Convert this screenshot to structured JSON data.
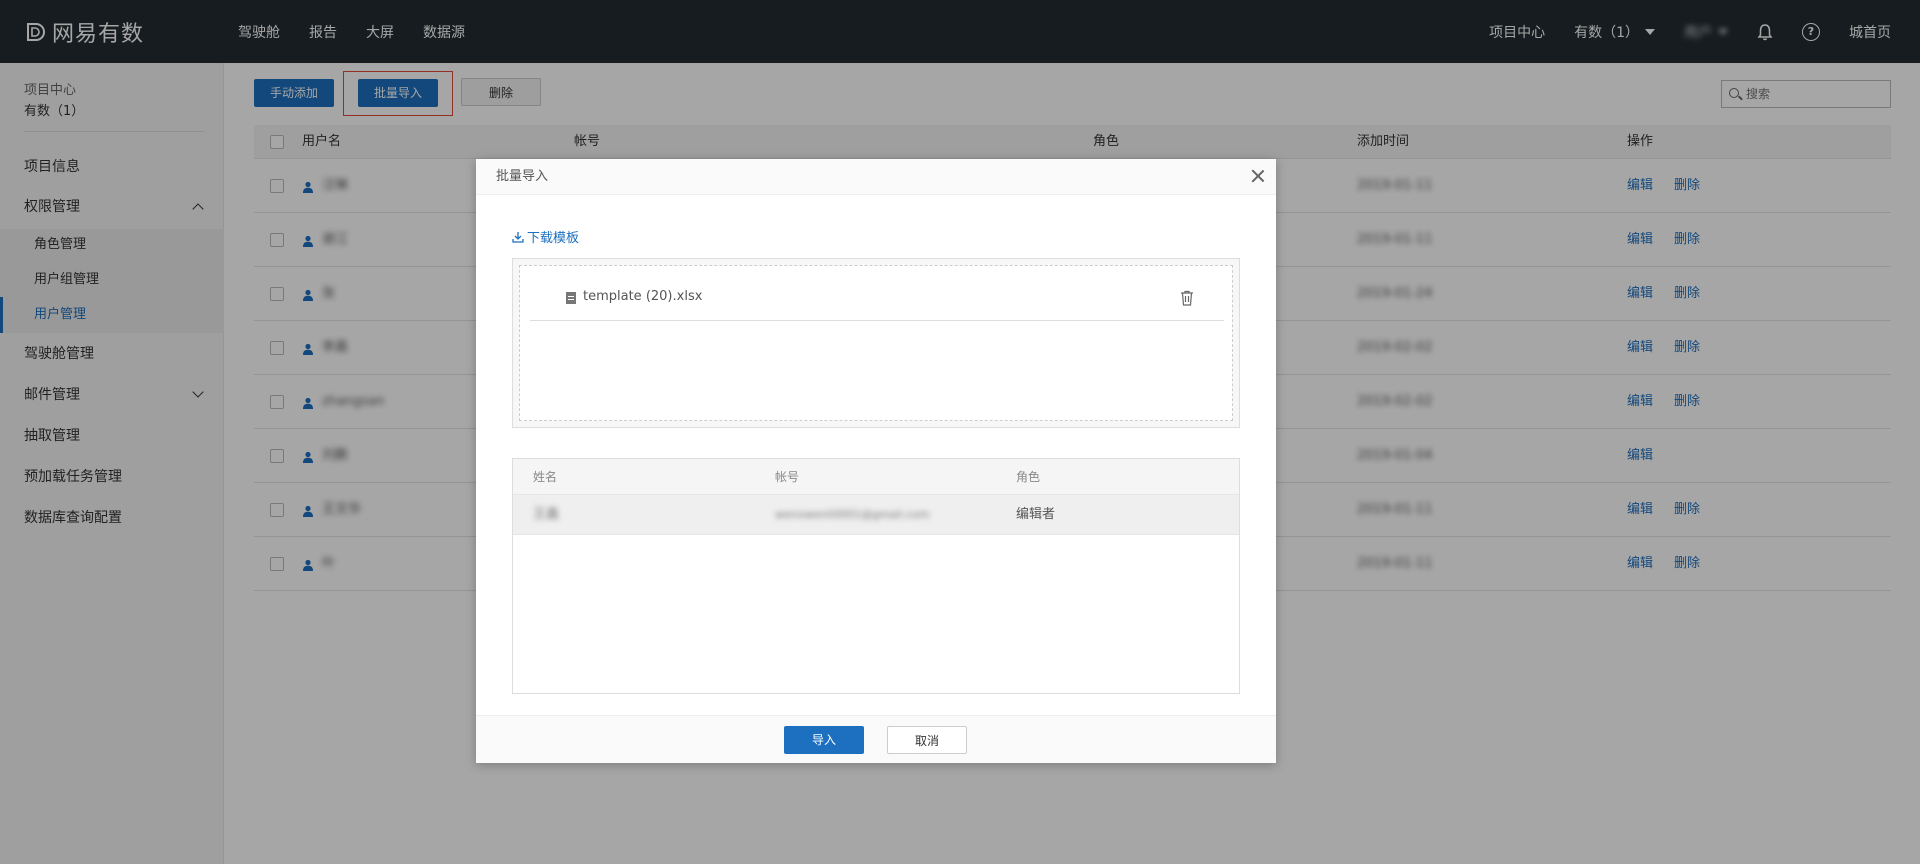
{
  "app": {
    "logo_text": "网易有数"
  },
  "topnav": [
    "驾驶舱",
    "报告",
    "大屏",
    "数据源"
  ],
  "topright": {
    "project_center": "项目中心",
    "current_project": "有数（1）",
    "user": "用户",
    "bell_icon": "bell-icon",
    "help_icon": "help-icon",
    "home": "城首页"
  },
  "sidebar": {
    "project_caption": "项目中心",
    "project_name": "有数（1）",
    "items": [
      {
        "label": "项目信息"
      },
      {
        "label": "权限管理",
        "expanded": true
      },
      {
        "label": "角色管理"
      },
      {
        "label": "用户组管理"
      },
      {
        "label": "用户管理",
        "active": true
      },
      {
        "label": "驾驶舱管理"
      },
      {
        "label": "邮件管理",
        "expanded": false
      },
      {
        "label": "抽取管理"
      },
      {
        "label": "预加载任务管理"
      },
      {
        "label": "数据库查询配置"
      }
    ]
  },
  "toolbar": {
    "add_label": "手动添加",
    "import_label": "批量导入",
    "delete_label": "删除",
    "search_placeholder": "搜索"
  },
  "table": {
    "headers": [
      "用户名",
      "帐号",
      "角色",
      "添加时间",
      "操作"
    ],
    "rows": [
      {
        "name": "汪琳",
        "added": "2019-01-11",
        "actions": [
          "编辑",
          "删除"
        ]
      },
      {
        "name": "谢江",
        "added": "2019-01-11",
        "actions": [
          "编辑",
          "删除"
        ]
      },
      {
        "name": "张",
        "added": "2019-01-24",
        "actions": [
          "编辑",
          "删除"
        ]
      },
      {
        "name": "李晨",
        "added": "2019-02-02",
        "actions": [
          "编辑",
          "删除"
        ]
      },
      {
        "name": "zhangsan",
        "added": "2019-02-02",
        "actions": [
          "编辑",
          "删除"
        ]
      },
      {
        "name": "刘鹏",
        "added": "2019-01-04",
        "actions": [
          "编辑"
        ]
      },
      {
        "name": "王文华",
        "added": "2019-01-11",
        "actions": [
          "编辑",
          "删除"
        ]
      },
      {
        "name": "叶",
        "added": "2019-01-11",
        "actions": [
          "编辑",
          "删除"
        ]
      }
    ]
  },
  "dialog": {
    "title": "批量导入",
    "download_label": "下载模板",
    "file_name": "template (20).xlsx",
    "preview_headers": [
      "姓名",
      "帐号",
      "角色"
    ],
    "preview_rows": [
      {
        "name": "王鑫",
        "account": "wenxwenli0001@gmail.com",
        "role": "编辑者"
      }
    ],
    "import_label": "导入",
    "cancel_label": "取消"
  },
  "colors": {
    "accent": "#1d6fbf",
    "topbar": "#222b31",
    "highlight": "#e14b3b"
  }
}
